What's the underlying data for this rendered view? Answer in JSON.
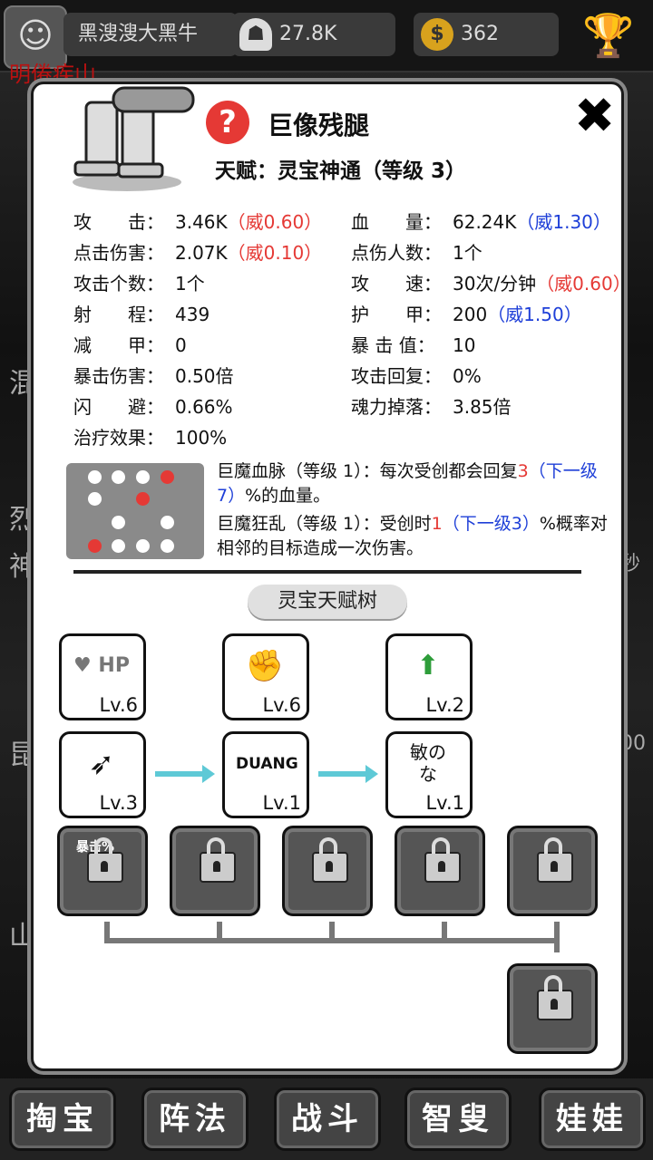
{
  "header": {
    "player_name": "黑溲溲大黑牛",
    "souls": "27.8K",
    "coins": "362"
  },
  "background": {
    "title": "明倦疾山",
    "side_texts": [
      "混",
      "烈",
      "神",
      "昆",
      "山"
    ],
    "right_texts": [
      "秒",
      "00"
    ]
  },
  "unit": {
    "name": "巨像残腿",
    "talent": "天赋：灵宝神通（等级 3）"
  },
  "stats_left": [
    {
      "label": "攻　　击：",
      "value": "3.46K",
      "note": "（威0.60）",
      "note_color": "#e53935"
    },
    {
      "label": "点击伤害：",
      "value": "2.07K",
      "note": "（威0.10）",
      "note_color": "#e53935"
    },
    {
      "label": "攻击个数：",
      "value": "1个",
      "note": "",
      "note_color": ""
    },
    {
      "label": "射　　程：",
      "value": "439",
      "note": "",
      "note_color": ""
    },
    {
      "label": "减　　甲：",
      "value": "0",
      "note": "",
      "note_color": ""
    },
    {
      "label": "暴击伤害：",
      "value": "0.50倍",
      "note": "",
      "note_color": ""
    },
    {
      "label": "闪　　避：",
      "value": "0.66%",
      "note": "",
      "note_color": ""
    },
    {
      "label": "治疗效果：",
      "value": "100%",
      "note": "",
      "note_color": ""
    }
  ],
  "stats_right": [
    {
      "label": "血　　量：",
      "value": "62.24K",
      "note": "（威1.30）",
      "note_color": "#1e3fd8"
    },
    {
      "label": "点伤人数：",
      "value": "1个",
      "note": "",
      "note_color": ""
    },
    {
      "label": "攻　　速：",
      "value": "30次/分钟",
      "note": "（威0.60）",
      "note_color": "#e53935"
    },
    {
      "label": "护　　甲：",
      "value": "200",
      "note": "（威1.50）",
      "note_color": "#1e3fd8"
    },
    {
      "label": "暴 击 值：",
      "value": "10",
      "note": "",
      "note_color": ""
    },
    {
      "label": "攻击回复：",
      "value": "0%",
      "note": "",
      "note_color": ""
    },
    {
      "label": "魂力掉落：",
      "value": "3.85倍",
      "note": "",
      "note_color": ""
    }
  ],
  "skills": [
    {
      "title": "巨魔血脉（等级 1）：每次受创都会回复",
      "value": "3",
      "next": "（下一级7）",
      "tail": "%的血量。"
    },
    {
      "title": "巨魔狂乱（等级 1）：受创时",
      "value": "1",
      "next": "（下一级3）",
      "tail": "%概率对相邻的目标造成一次伤害。"
    }
  ],
  "tree": {
    "title": "灵宝天赋树",
    "nodes_row1": [
      {
        "icon": "hp-heart-icon",
        "art": "HP",
        "level": "Lv.6"
      },
      {
        "icon": "stone-fist-icon",
        "art": "✊",
        "level": "Lv.6"
      },
      {
        "icon": "green-arrow-coin-icon",
        "art": "⬆",
        "level": "Lv.2"
      }
    ],
    "nodes_row2": [
      {
        "icon": "arrow-target-icon",
        "art": "➶",
        "level": "Lv.3"
      },
      {
        "icon": "duang-text-icon",
        "art": "DUANG",
        "level": "Lv.1"
      },
      {
        "icon": "min-no-na-text-icon",
        "art": "敏の な",
        "level": "Lv.1"
      }
    ],
    "locked_label": "暴击%"
  },
  "nav": [
    "掏宝",
    "阵法",
    "战斗",
    "智叟",
    "娃娃"
  ]
}
